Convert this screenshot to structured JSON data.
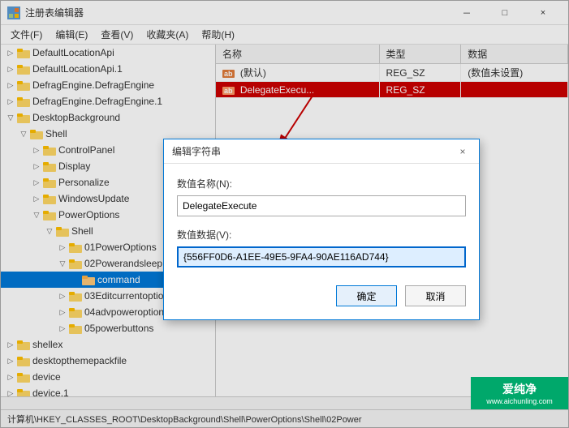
{
  "window": {
    "title": "注册表编辑器",
    "controls": {
      "minimize": "－",
      "maximize": "□",
      "close": "×"
    }
  },
  "menu": {
    "items": [
      "文件(F)",
      "编辑(E)",
      "查看(V)",
      "收藏夹(A)",
      "帮助(H)"
    ]
  },
  "tree": {
    "items": [
      {
        "label": "DefaultLocationApi",
        "level": 0,
        "expanded": false
      },
      {
        "label": "DefaultLocationApi.1",
        "level": 0,
        "expanded": false
      },
      {
        "label": "DefragEngine.DefragEngine",
        "level": 0,
        "expanded": false
      },
      {
        "label": "DefragEngine.DefragEngine.1",
        "level": 0,
        "expanded": false
      },
      {
        "label": "DesktopBackground",
        "level": 0,
        "expanded": true
      },
      {
        "label": "Shell",
        "level": 1,
        "expanded": true
      },
      {
        "label": "ControlPanel",
        "level": 2,
        "expanded": false
      },
      {
        "label": "Display",
        "level": 2,
        "expanded": false
      },
      {
        "label": "Personalize",
        "level": 2,
        "expanded": false
      },
      {
        "label": "WindowsUpdate",
        "level": 2,
        "expanded": false
      },
      {
        "label": "PowerOptions",
        "level": 2,
        "expanded": true
      },
      {
        "label": "Shell",
        "level": 3,
        "expanded": true
      },
      {
        "label": "01PowerOptions",
        "level": 4,
        "expanded": false
      },
      {
        "label": "02Powerandsleep",
        "level": 4,
        "expanded": true
      },
      {
        "label": "command",
        "level": 5,
        "expanded": false,
        "selected": true
      },
      {
        "label": "03Editcurrentoptio",
        "level": 4,
        "expanded": false
      },
      {
        "label": "04advpoweroption",
        "level": 4,
        "expanded": false
      },
      {
        "label": "05powerbuttons",
        "level": 4,
        "expanded": false
      },
      {
        "label": "shellex",
        "level": 0,
        "expanded": false
      },
      {
        "label": "desktopthemepackfile",
        "level": 0,
        "expanded": false
      },
      {
        "label": "device",
        "level": 0,
        "expanded": false
      },
      {
        "label": "device.1",
        "level": 0,
        "expanded": false
      }
    ]
  },
  "table": {
    "headers": [
      "名称",
      "类型",
      "数据"
    ],
    "rows": [
      {
        "name": "(默认)",
        "type": "REG_SZ",
        "data": "(数值未设置)",
        "selected": false,
        "icon": "ab"
      },
      {
        "name": "DelegateExecu...",
        "type": "REG_SZ",
        "data": "",
        "selected": true,
        "icon": "ab"
      }
    ]
  },
  "dialog": {
    "title": "编辑字符串",
    "name_label": "数值名称(N):",
    "name_value": "DelegateExecute",
    "data_label": "数值数据(V):",
    "data_value": "{556FF0D6-A1EE-49E5-9FA4-90AE116AD744}",
    "ok_button": "确定",
    "cancel_button": "取消"
  },
  "status_bar": {
    "text": "计算机\\HKEY_CLASSES_ROOT\\DesktopBackground\\Shell\\PowerOptions\\Shell\\02Power"
  },
  "watermark": {
    "line1": "爱纯净",
    "line2": "www.aichunling.com"
  }
}
